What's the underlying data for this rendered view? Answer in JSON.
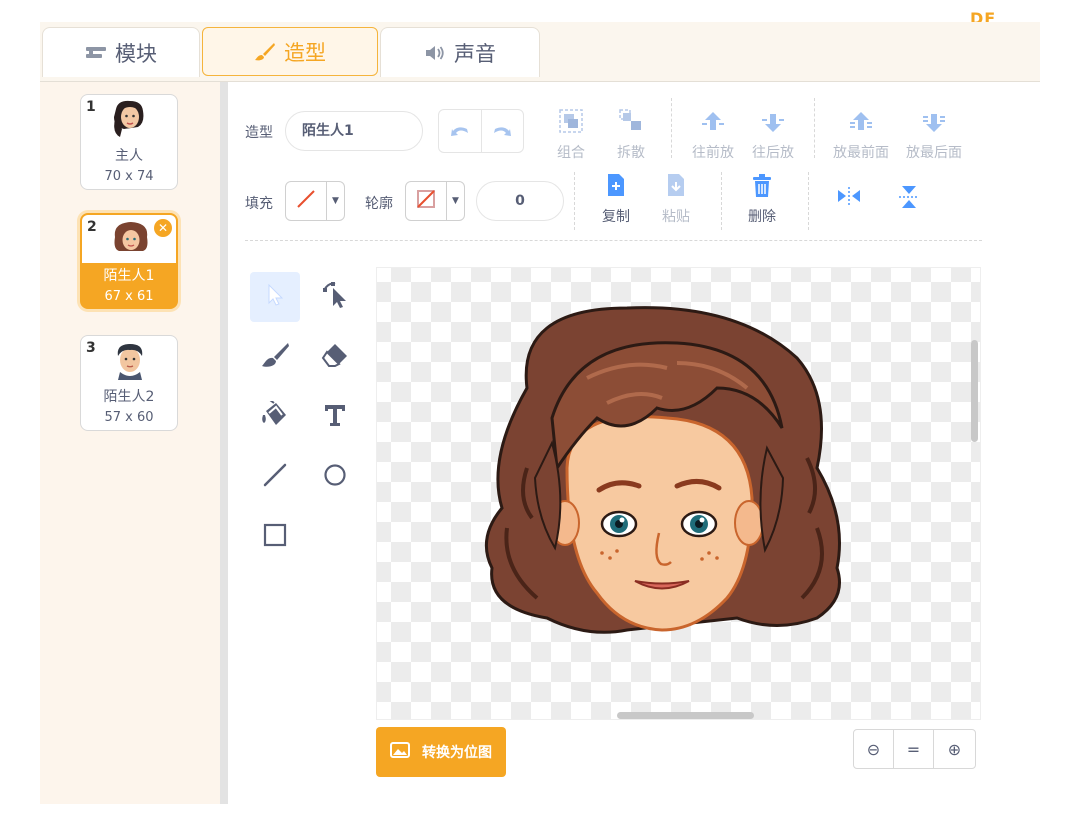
{
  "tabs": [
    {
      "label": "模块",
      "icon": "blocks-icon"
    },
    {
      "label": "造型",
      "icon": "brush-icon"
    },
    {
      "label": "声音",
      "icon": "speaker-icon"
    }
  ],
  "logo": "DF",
  "costumes": [
    {
      "number": "1",
      "name": "主人",
      "size": "70 x 74"
    },
    {
      "number": "2",
      "name": "陌生人1",
      "size": "67 x 61",
      "selected": true
    },
    {
      "number": "3",
      "name": "陌生人2",
      "size": "57 x 60"
    }
  ],
  "toolbar": {
    "costume_label": "造型",
    "costume_name": "陌生人1",
    "group": "组合",
    "ungroup": "拆散",
    "forward": "往前放",
    "backward": "往后放",
    "front": "放最前面",
    "back": "放最后面",
    "fill_label": "填充",
    "outline_label": "轮廓",
    "outline_width": "0",
    "copy": "复制",
    "paste": "粘贴",
    "delete": "删除"
  },
  "paint_tools": [
    "select-icon",
    "reshape-icon",
    "brush-icon",
    "eraser-icon",
    "fill-icon",
    "text-icon",
    "line-icon",
    "circle-icon",
    "rect-icon"
  ],
  "convert_button": "转换为位图",
  "zoom": {
    "out": "⊖",
    "reset": "=",
    "in": "⊕"
  },
  "colors": {
    "accent": "#f5a623",
    "text": "#575e75",
    "disabled": "#b6bcc8",
    "blue": "#4c97ff"
  }
}
